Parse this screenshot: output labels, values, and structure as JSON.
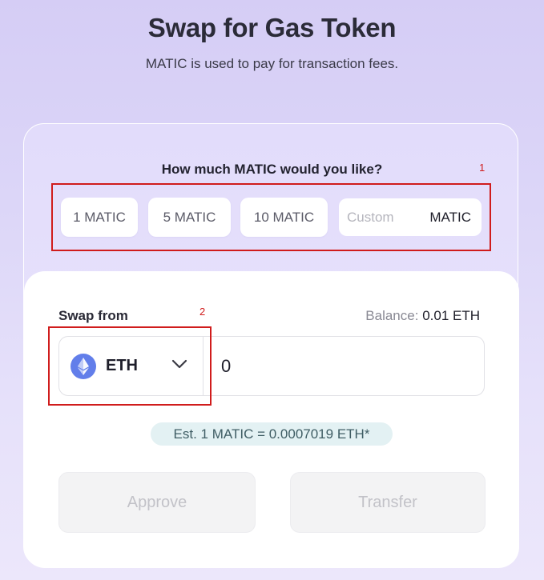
{
  "header": {
    "title": "Swap for Gas Token",
    "subtitle": "MATIC is used to pay for transaction fees."
  },
  "amount_selector": {
    "question": "How much MATIC would you like?",
    "options": [
      {
        "label": "1 MATIC"
      },
      {
        "label": "5 MATIC"
      },
      {
        "label": "10 MATIC"
      }
    ],
    "custom": {
      "placeholder": "Custom",
      "value": "",
      "unit": "MATIC"
    }
  },
  "swap": {
    "label": "Swap from",
    "balance_label": "Balance:",
    "balance_value": "0.01 ETH",
    "token": {
      "symbol": "ETH",
      "icon": "ethereum-icon"
    },
    "amount": "0",
    "rate": "Est. 1 MATIC = 0.0007019 ETH*"
  },
  "actions": {
    "approve_label": "Approve",
    "transfer_label": "Transfer"
  },
  "annotations": [
    {
      "number": "1"
    },
    {
      "number": "2"
    }
  ],
  "colors": {
    "annotation": "#d01c1c",
    "eth_logo": "#627eea",
    "rate_pill": "#e3f1f3",
    "background": "#d5cdf5"
  }
}
